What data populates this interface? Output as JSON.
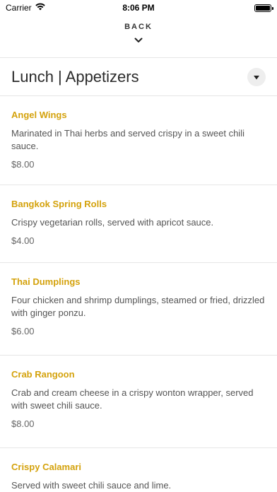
{
  "status": {
    "carrier": "Carrier",
    "time": "8:06 PM"
  },
  "nav": {
    "back_label": "BACK"
  },
  "menu": {
    "title": "Lunch | Appetizers"
  },
  "items": [
    {
      "name": "Angel Wings",
      "description": "Marinated in Thai herbs and served crispy in a sweet chili sauce.",
      "price": "$8.00"
    },
    {
      "name": "Bangkok Spring Rolls",
      "description": "Crispy vegetarian rolls, served with apricot sauce.",
      "price": "$4.00"
    },
    {
      "name": "Thai Dumplings",
      "description": "Four chicken and shrimp dumplings, steamed or fried, drizzled with ginger ponzu.",
      "price": "$6.00"
    },
    {
      "name": "Crab Rangoon",
      "description": "Crab and cream cheese in a crispy wonton wrapper, served with sweet chili sauce.",
      "price": "$8.00"
    },
    {
      "name": "Crispy Calamari",
      "description": "Served with sweet chili sauce and lime.",
      "price": ""
    }
  ],
  "colors": {
    "item_name": "#d4a20c",
    "divider": "#e6e6e6"
  },
  "icons": {
    "wifi": "wifi-icon",
    "battery": "battery-icon",
    "back_chevron": "chevron-down-icon",
    "dropdown": "caret-down-icon"
  }
}
